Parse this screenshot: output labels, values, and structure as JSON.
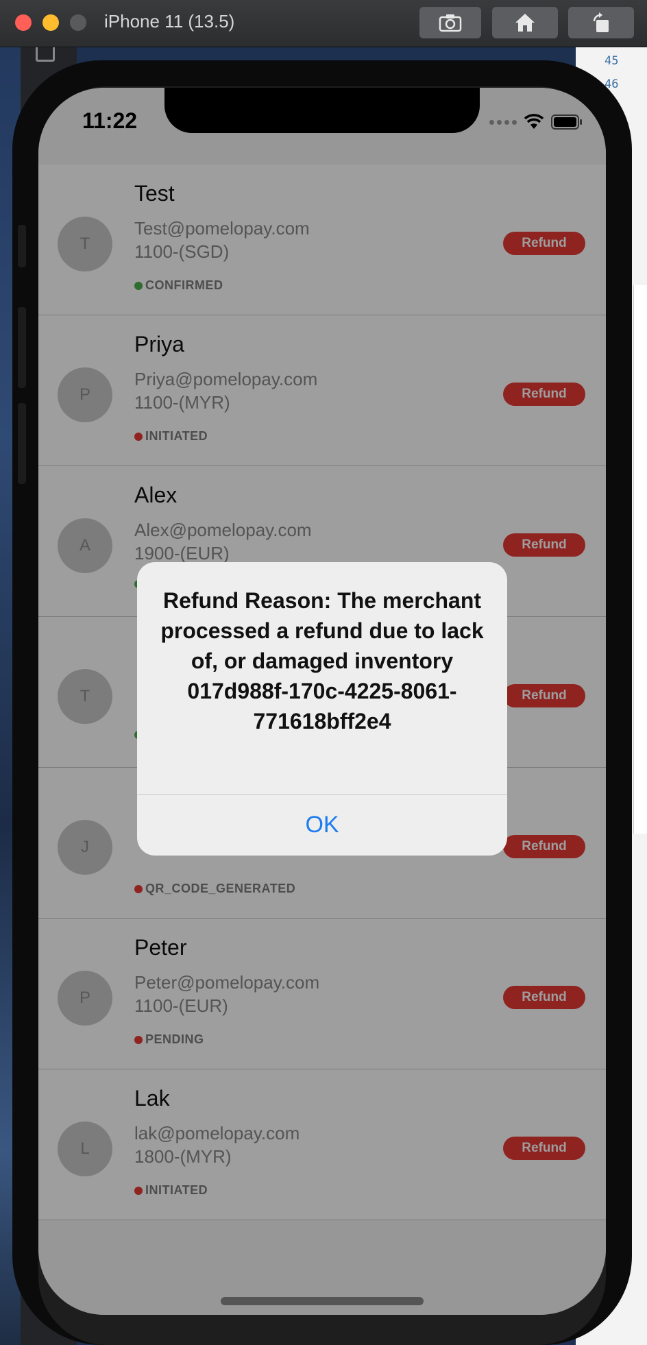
{
  "window": {
    "title": "iPhone 11 (13.5)"
  },
  "toolbar": [
    {
      "name": "screenshot-button",
      "icon": "camera-icon"
    },
    {
      "name": "home-button",
      "icon": "home-icon"
    },
    {
      "name": "rotate-button",
      "icon": "rotate-icon"
    }
  ],
  "editor": {
    "line_numbers": [
      "45",
      "46"
    ]
  },
  "status_bar": {
    "time": "11:22"
  },
  "transactions": [
    {
      "initial": "T",
      "name": "Test",
      "email": "Test@pomelopay.com",
      "amount": "1100-(SGD)",
      "status": "CONFIRMED",
      "status_color": "#4caf50",
      "action": "Refund"
    },
    {
      "initial": "P",
      "name": "Priya",
      "email": "Priya@pomelopay.com",
      "amount": "1100-(MYR)",
      "status": "INITIATED",
      "status_color": "#e53935",
      "action": "Refund"
    },
    {
      "initial": "A",
      "name": "Alex",
      "email": "Alex@pomelopay.com",
      "amount": "1900-(EUR)",
      "status": "",
      "status_color": "#4caf50",
      "action": "Refund"
    },
    {
      "initial": "T",
      "name": "",
      "email": "",
      "amount": "",
      "status": "",
      "status_color": "#4caf50",
      "action": "Refund"
    },
    {
      "initial": "J",
      "name": "",
      "email": "",
      "amount": "",
      "status": "QR_CODE_GENERATED",
      "status_color": "#e53935",
      "action": "Refund"
    },
    {
      "initial": "P",
      "name": "Peter",
      "email": "Peter@pomelopay.com",
      "amount": "1100-(EUR)",
      "status": "PENDING",
      "status_color": "#e53935",
      "action": "Refund"
    },
    {
      "initial": "L",
      "name": "Lak",
      "email": "lak@pomelopay.com",
      "amount": "1800-(MYR)",
      "status": "INITIATED",
      "status_color": "#e53935",
      "action": "Refund"
    }
  ],
  "alert": {
    "message": "Refund Reason: The merchant processed a refund due to lack of, or damaged inventory 017d988f-170c-4225-8061-771618bff2e4",
    "ok_label": "OK"
  }
}
